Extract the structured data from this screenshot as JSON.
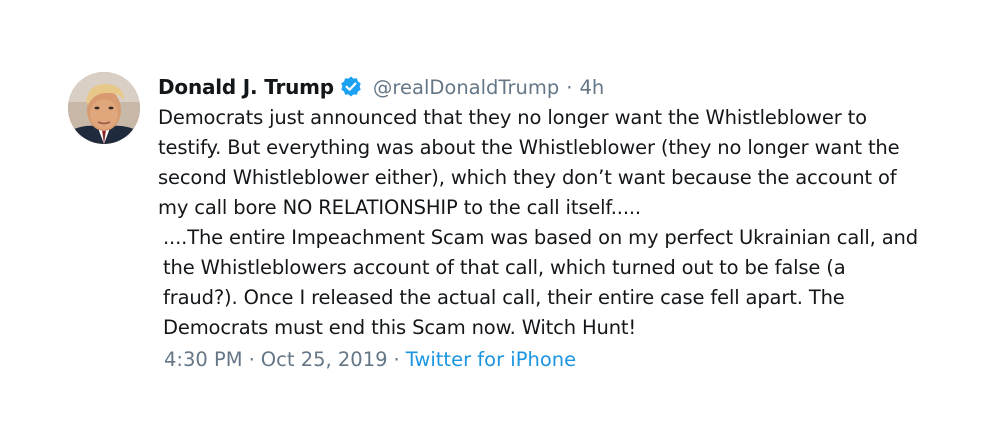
{
  "tweet": {
    "author_name": "Donald J. Trump",
    "handle": "@realDonaldTrump",
    "separator": "·",
    "relative_time": "4h",
    "verified_icon": "verified-badge-icon",
    "paragraph1": "Democrats just announced that they no longer want the Whistleblower to\ntestify. But everything was about the Whistleblower (they no longer want the\nsecond Whistleblower either), which they don’t want because the account of\nmy call bore NO RELATIONSHIP to the call itself.....",
    "paragraph2": "....The entire Impeachment Scam was based on my perfect Ukrainian call, and\nthe Whistleblowers account of that call, which turned out to be false (a\nfraud?). Once I released the actual call, their entire case fell apart. The\nDemocrats must end this Scam now. Witch Hunt!",
    "footer": {
      "time": "4:30 PM",
      "date": "Oct 25, 2019",
      "separator": "·",
      "source": "Twitter for iPhone"
    }
  },
  "colors": {
    "text": "#14171a",
    "secondary": "#657786",
    "link": "#1b95e0",
    "verified": "#1da1f2"
  }
}
